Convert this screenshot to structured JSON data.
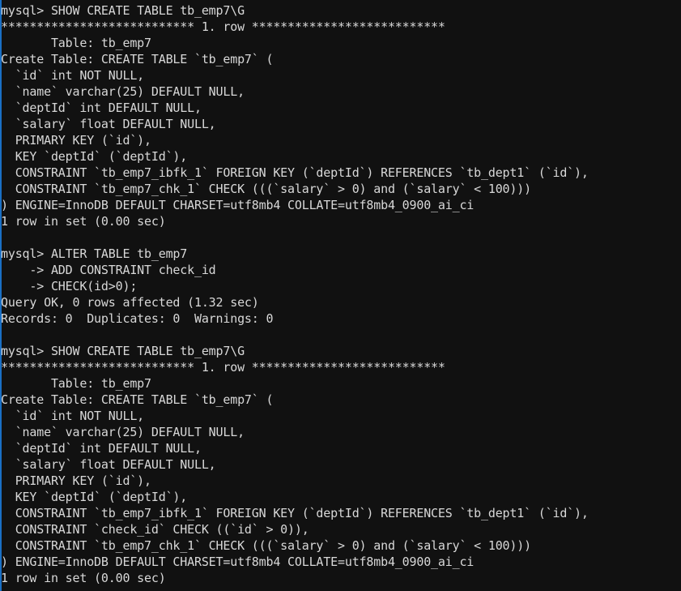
{
  "terminal": {
    "prompt": "mysql> ",
    "continuation": "    -> ",
    "colors": {
      "background": "#111111",
      "foreground": "#d8d8d8",
      "accent_stripe": "#1a6fc4"
    },
    "row_separator": "*************************** 1. row ***************************"
  },
  "session": {
    "lines": [
      "mysql> SHOW CREATE TABLE tb_emp7\\G",
      "*************************** 1. row ***************************",
      "       Table: tb_emp7",
      "Create Table: CREATE TABLE `tb_emp7` (",
      "  `id` int NOT NULL,",
      "  `name` varchar(25) DEFAULT NULL,",
      "  `deptId` int DEFAULT NULL,",
      "  `salary` float DEFAULT NULL,",
      "  PRIMARY KEY (`id`),",
      "  KEY `deptId` (`deptId`),",
      "  CONSTRAINT `tb_emp7_ibfk_1` FOREIGN KEY (`deptId`) REFERENCES `tb_dept1` (`id`),",
      "  CONSTRAINT `tb_emp7_chk_1` CHECK (((`salary` > 0) and (`salary` < 100)))",
      ") ENGINE=InnoDB DEFAULT CHARSET=utf8mb4 COLLATE=utf8mb4_0900_ai_ci",
      "1 row in set (0.00 sec)",
      "",
      "mysql> ALTER TABLE tb_emp7",
      "    -> ADD CONSTRAINT check_id",
      "    -> CHECK(id>0);",
      "Query OK, 0 rows affected (1.32 sec)",
      "Records: 0  Duplicates: 0  Warnings: 0",
      "",
      "mysql> SHOW CREATE TABLE tb_emp7\\G",
      "*************************** 1. row ***************************",
      "       Table: tb_emp7",
      "Create Table: CREATE TABLE `tb_emp7` (",
      "  `id` int NOT NULL,",
      "  `name` varchar(25) DEFAULT NULL,",
      "  `deptId` int DEFAULT NULL,",
      "  `salary` float DEFAULT NULL,",
      "  PRIMARY KEY (`id`),",
      "  KEY `deptId` (`deptId`),",
      "  CONSTRAINT `tb_emp7_ibfk_1` FOREIGN KEY (`deptId`) REFERENCES `tb_dept1` (`id`),",
      "  CONSTRAINT `check_id` CHECK ((`id` > 0)),",
      "  CONSTRAINT `tb_emp7_chk_1` CHECK (((`salary` > 0) and (`salary` < 100)))",
      ") ENGINE=InnoDB DEFAULT CHARSET=utf8mb4 COLLATE=utf8mb4_0900_ai_ci",
      "1 row in set (0.00 sec)"
    ]
  }
}
